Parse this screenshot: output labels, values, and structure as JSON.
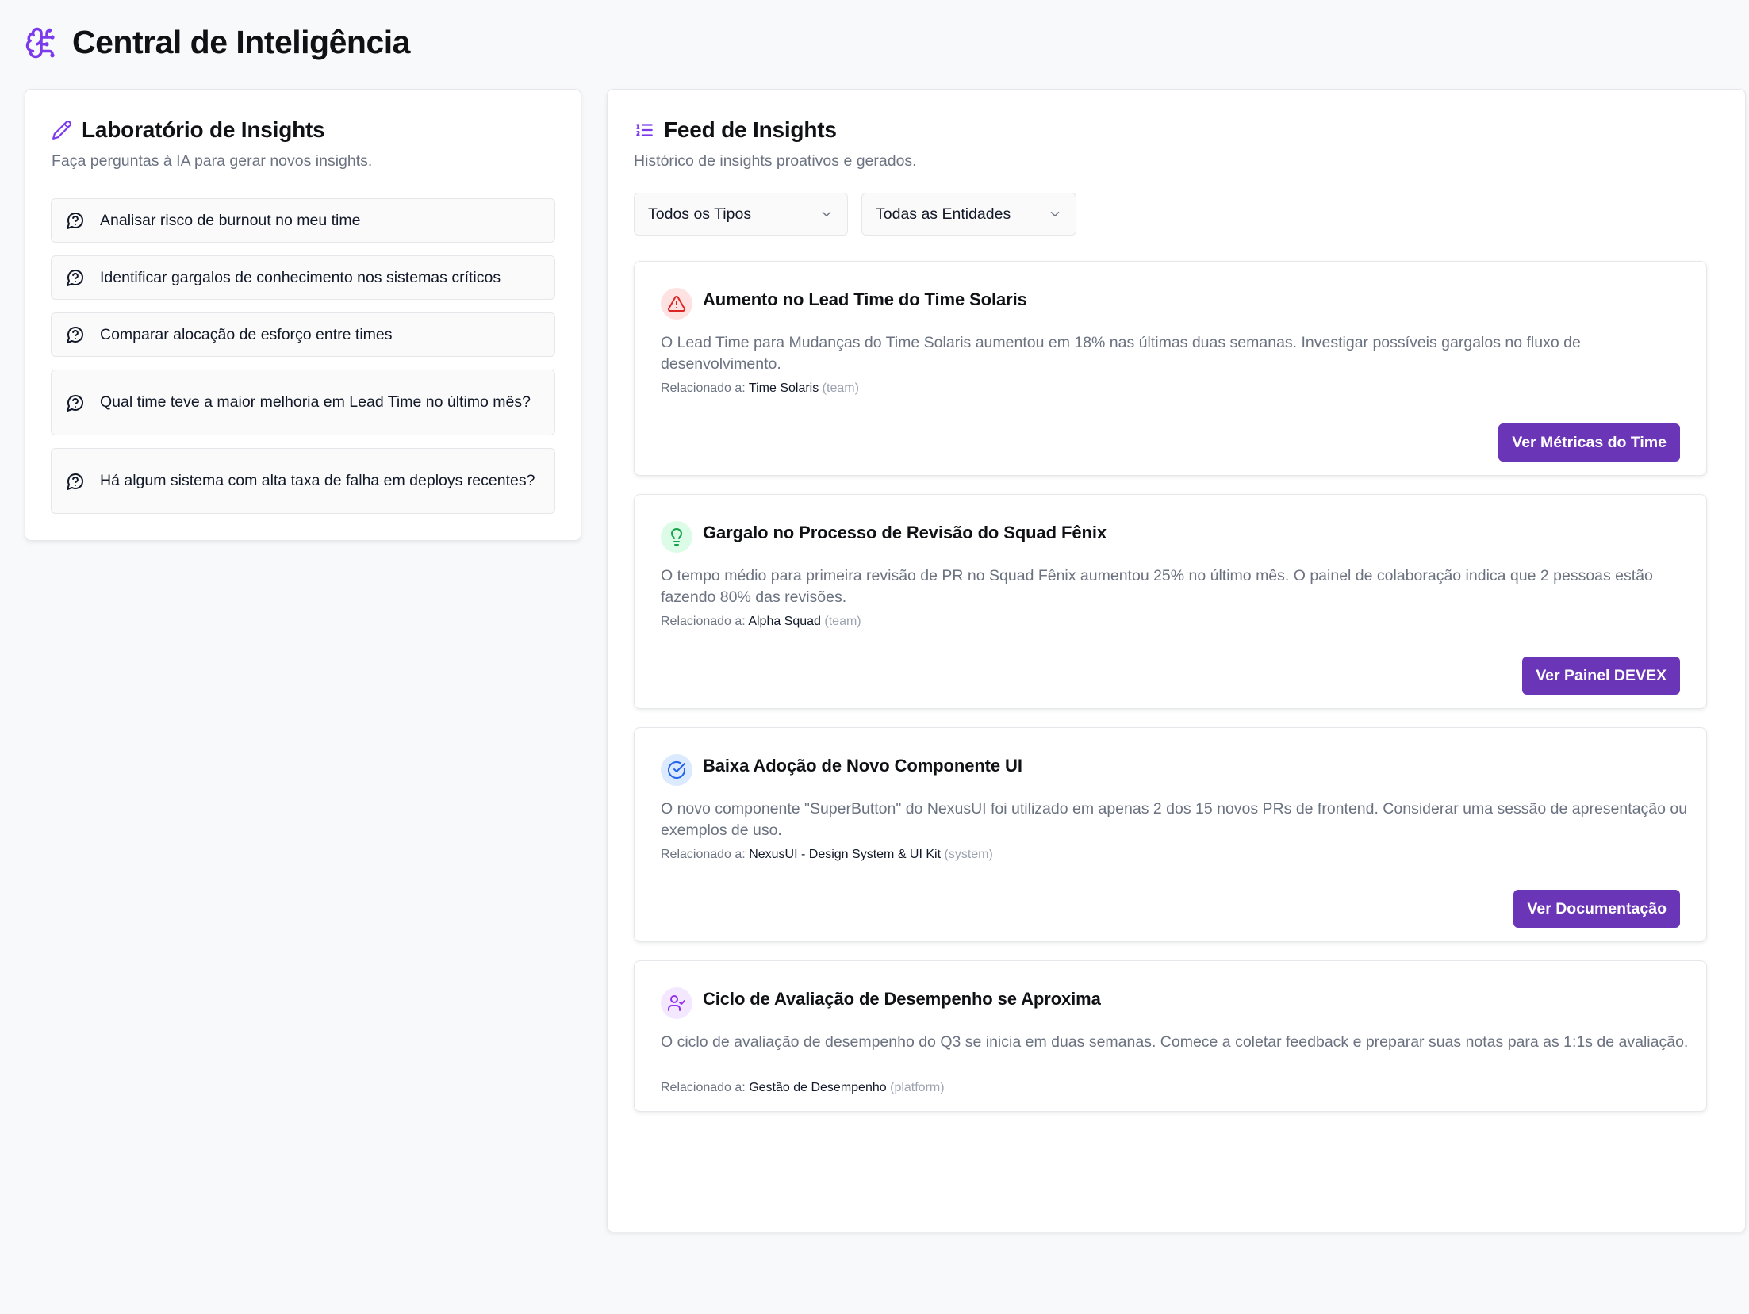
{
  "header": {
    "title": "Central de Inteligência",
    "icon": "brain-icon"
  },
  "lab": {
    "title": "Laboratório de Insights",
    "subtitle": "Faça perguntas à IA para gerar novos insights.",
    "prompts": [
      "Analisar risco de burnout no meu time",
      "Identificar gargalos de conhecimento nos sistemas críticos",
      "Comparar alocação de esforço entre times",
      "Qual time teve a maior melhoria em Lead Time no último mês?",
      "Há algum sistema com alta taxa de falha em deploys recentes?"
    ]
  },
  "feed": {
    "title": "Feed de Insights",
    "subtitle": "Histórico de insights proativos e gerados.",
    "filters": {
      "type": "Todos os Tipos",
      "entity": "Todas as Entidades"
    },
    "related_label": "Relacionado a:",
    "items": [
      {
        "icon": "alert-triangle-icon",
        "title": "Aumento no Lead Time do Time Solaris",
        "description": "O Lead Time para Mudanças do Time Solaris aumentou em 18% nas últimas duas semanas. Investigar possíveis gargalos no fluxo de desenvolvimento.",
        "entity": "Time Solaris",
        "entity_type": "(team)",
        "action": "Ver Métricas do Time"
      },
      {
        "icon": "lightbulb-icon",
        "title": "Gargalo no Processo de Revisão do Squad Fênix",
        "description": "O tempo médio para primeira revisão de PR no Squad Fênix aumentou 25% no último mês. O painel de colaboração indica que 2 pessoas estão fazendo 80% das revisões.",
        "entity": "Alpha Squad",
        "entity_type": "(team)",
        "action": "Ver Painel DEVEX"
      },
      {
        "icon": "check-circle-icon",
        "title": "Baixa Adoção de Novo Componente UI",
        "description": "O novo componente \"SuperButton\" do NexusUI foi utilizado em apenas 2 dos 15 novos PRs de frontend. Considerar uma sessão de apresentação ou exemplos de uso.",
        "entity": "NexusUI - Design System & UI Kit",
        "entity_type": "(system)",
        "action": "Ver Documentação"
      },
      {
        "icon": "user-check-icon",
        "title": "Ciclo de Avaliação de Desempenho se Aproxima",
        "description": "O ciclo de avaliação de desempenho do Q3 se inicia em duas semanas. Comece a coletar feedback e preparar suas notas para as 1:1s de avaliação.",
        "entity": "Gestão de Desempenho",
        "entity_type": "(platform)"
      }
    ]
  },
  "colors": {
    "accent": "#6b35b7",
    "alert": "#dc2626",
    "success": "#16a34a",
    "info": "#2563eb",
    "purple": "#9333ea"
  }
}
